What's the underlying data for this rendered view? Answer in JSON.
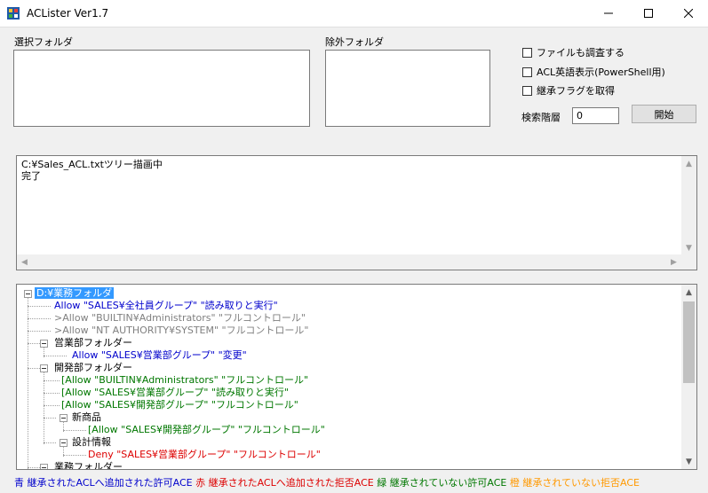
{
  "window": {
    "title": "ACLister Ver1.7"
  },
  "colors": {
    "blue": "#0000cc",
    "red": "#dd0000",
    "green": "#007700",
    "orange": "#ff9900",
    "gray": "#808080"
  },
  "labels": {
    "select_folder": "選択フォルダ",
    "exclude_folder": "除外フォルダ",
    "depth": "検索階層"
  },
  "options": {
    "include_files": "ファイルも調査する",
    "acl_english": "ACL英語表示(PowerShell用)",
    "inherit_flag": "継承フラグを取得"
  },
  "depth_value": "0",
  "start_button": "開始",
  "log": {
    "line1": "C:¥Sales_ACL.txtツリー描画中",
    "line2": "完了"
  },
  "tree": {
    "root": "D:¥業務フォルダ",
    "r1": "Allow \"SALES¥全社員グループ\" \"読み取りと実行\"",
    "r2": ">Allow \"BUILTIN¥Administrators\" \"フルコントロール\"",
    "r3": ">Allow \"NT AUTHORITY¥SYSTEM\" \"フルコントロール\"",
    "sales": "営業部フォルダー",
    "s1": "Allow \"SALES¥営業部グループ\" \"変更\"",
    "dev": "開発部フォルダー",
    "d1": "[Allow \"BUILTIN¥Administrators\" \"フルコントロール\"",
    "d2": "[Allow \"SALES¥営業部グループ\" \"読み取りと実行\"",
    "d3": "[Allow \"SALES¥開発部グループ\" \"フルコントロール\"",
    "new": "新商品",
    "n1": "[Allow \"SALES¥開発部グループ\" \"フルコントロール\"",
    "design": "設計情報",
    "x1": "Deny \"SALES¥営業部グループ\" \"フルコントロール\"",
    "next": "業務フォルダー"
  },
  "legend": {
    "blue": "青 継承されたACLへ追加された許可ACE",
    "red": "赤 継承されたACLへ追加された拒否ACE",
    "green": "緑 継承されていない許可ACE",
    "orange": "橙 継承されていない拒否ACE"
  }
}
